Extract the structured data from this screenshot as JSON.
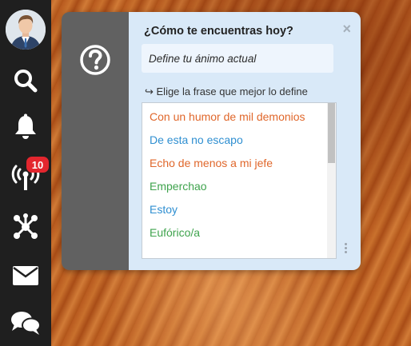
{
  "sidebar": {
    "items": [
      {
        "name": "search-icon"
      },
      {
        "name": "bell-icon"
      },
      {
        "name": "broadcast-icon",
        "badge": "10"
      },
      {
        "name": "network-icon"
      },
      {
        "name": "envelope-icon"
      },
      {
        "name": "chat-icon"
      }
    ],
    "badge_color": "#e3262e"
  },
  "dialog": {
    "title": "¿Cómo te encuentras hoy?",
    "close_label": "×",
    "input_placeholder": "Define tu ánimo actual",
    "hint": "↪ Elige la frase que mejor lo define",
    "options": [
      {
        "label": "Con un humor de mil demonios",
        "color": "#e0672b"
      },
      {
        "label": "De esta no escapo",
        "color": "#2f8fd1"
      },
      {
        "label": "Echo de menos a mi jefe",
        "color": "#e0672b"
      },
      {
        "label": "Emperchao",
        "color": "#3fa34d"
      },
      {
        "label": "Estoy",
        "color": "#2f8fd1"
      },
      {
        "label": "Eufórico/a",
        "color": "#3fa34d"
      }
    ]
  }
}
